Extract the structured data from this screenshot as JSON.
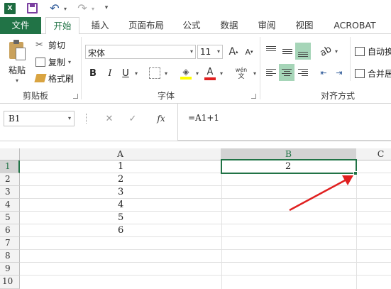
{
  "qat": {
    "app_icon": "excel-icon",
    "save_icon": "save-icon",
    "undo_icon": "undo-icon",
    "redo_icon": "redo-icon",
    "customize_icon": "customize-qat-icon"
  },
  "tabs": [
    {
      "label": "文件"
    },
    {
      "label": "开始"
    },
    {
      "label": "插入"
    },
    {
      "label": "页面布局"
    },
    {
      "label": "公式"
    },
    {
      "label": "数据"
    },
    {
      "label": "审阅"
    },
    {
      "label": "视图"
    },
    {
      "label": "ACROBAT"
    }
  ],
  "ribbon": {
    "clipboard": {
      "paste": "粘贴",
      "cut": "剪切",
      "copy": "复制",
      "format_painter": "格式刷",
      "group": "剪贴板"
    },
    "font": {
      "name": "宋体",
      "size": "11",
      "grow": "A",
      "shrink": "A",
      "bold": "B",
      "italic": "I",
      "underline": "U",
      "font_color": "A",
      "phonetic": "wén",
      "group": "字体"
    },
    "alignment": {
      "wrap": "自动换",
      "merge": "合并居",
      "group": "对齐方式"
    }
  },
  "formula_bar": {
    "name_box": "B1",
    "cancel": "✕",
    "enter": "✓",
    "fx": "fx",
    "formula": "=A1+1"
  },
  "sheet": {
    "columns": [
      "A",
      "B",
      "C"
    ],
    "rows": [
      "1",
      "2",
      "3",
      "4",
      "5",
      "6",
      "7",
      "8",
      "9",
      "10"
    ],
    "col_a_values": [
      "1",
      "2",
      "3",
      "4",
      "5",
      "6"
    ],
    "b1_value": "2",
    "selected_cell": "B1"
  },
  "colors": {
    "accent": "#217346",
    "arrow": "#e02020",
    "fill_highlight": "#ffff00",
    "font_red": "#e02020"
  }
}
